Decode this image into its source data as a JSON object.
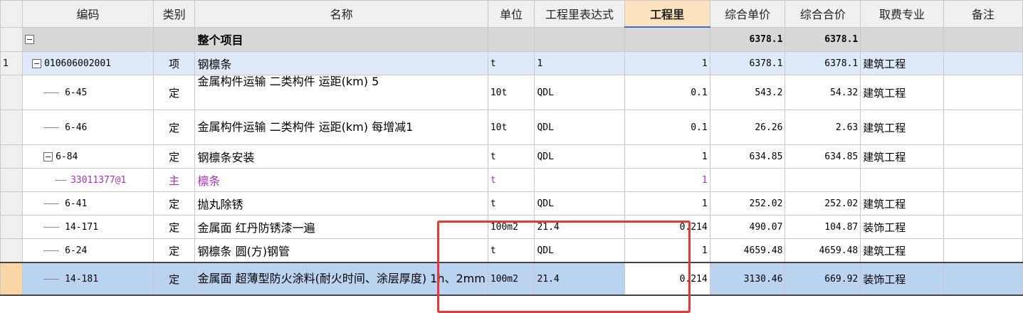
{
  "columns": {
    "code": "编码",
    "type": "类别",
    "name": "名称",
    "unit": "单位",
    "expr": "工程里表达式",
    "qty": "工程里",
    "unit_price": "综合单价",
    "total_price": "综合合价",
    "fee_type": "取费专业",
    "remark": "备注"
  },
  "total_row": {
    "name": "整个项目",
    "unit_price": "6378.1",
    "total_price": "6378.1"
  },
  "rows": [
    {
      "num": "1",
      "code": "010606002001",
      "type": "项",
      "name": "钢檩条",
      "unit": "t",
      "expr": "1",
      "qty": "1",
      "unit_price": "6378.1",
      "total_price": "6378.1",
      "fee": "建筑工程"
    },
    {
      "num": "",
      "code": "6-45",
      "type": "定",
      "name": "金属构件运输 二类构件 运距(km) 5",
      "unit": "10t",
      "expr": "QDL",
      "qty": "0.1",
      "unit_price": "543.2",
      "total_price": "54.32",
      "fee": "建筑工程"
    },
    {
      "num": "",
      "code": "6-46",
      "type": "定",
      "name": "金属构件运输 二类构件 运距(km) 每增减1",
      "unit": "10t",
      "expr": "QDL",
      "qty": "0.1",
      "unit_price": "26.26",
      "total_price": "2.63",
      "fee": "建筑工程"
    },
    {
      "num": "",
      "code": "6-84",
      "type": "定",
      "name": "钢檩条安装",
      "unit": "t",
      "expr": "QDL",
      "qty": "1",
      "unit_price": "634.85",
      "total_price": "634.85",
      "fee": "建筑工程"
    },
    {
      "num": "",
      "code": "33011377@1",
      "type": "主",
      "name": "檩条",
      "unit": "t",
      "expr": "",
      "qty": "1",
      "unit_price": "",
      "total_price": "",
      "fee": ""
    },
    {
      "num": "",
      "code": "6-41",
      "type": "定",
      "name": "抛丸除锈",
      "unit": "t",
      "expr": "QDL",
      "qty": "1",
      "unit_price": "252.02",
      "total_price": "252.02",
      "fee": "建筑工程"
    },
    {
      "num": "",
      "code": "14-171",
      "type": "定",
      "name": "金属面 红丹防锈漆一遍",
      "unit": "100m2",
      "expr": "21.4",
      "qty": "0.214",
      "unit_price": "490.07",
      "total_price": "104.87",
      "fee": "装饰工程"
    },
    {
      "num": "",
      "code": "6-24",
      "type": "定",
      "name": "钢檩条 圆(方)钢管",
      "unit": "t",
      "expr": "QDL",
      "qty": "1",
      "unit_price": "4659.48",
      "total_price": "4659.48",
      "fee": "建筑工程"
    },
    {
      "num": "",
      "code": "14-181",
      "type": "定",
      "name": "金属面 超薄型防火涂料(耐火时间、涂层厚度) 1h、2mm",
      "unit": "100m2",
      "expr": "21.4",
      "qty": "0.214",
      "unit_price": "3130.46",
      "total_price": "669.92",
      "fee": "装饰工程"
    }
  ],
  "colors": {
    "highlight_box": "#e53935",
    "selected_row": "#b9d3f0",
    "item_row": "#deeaf9",
    "main_material": "#a533b5"
  }
}
